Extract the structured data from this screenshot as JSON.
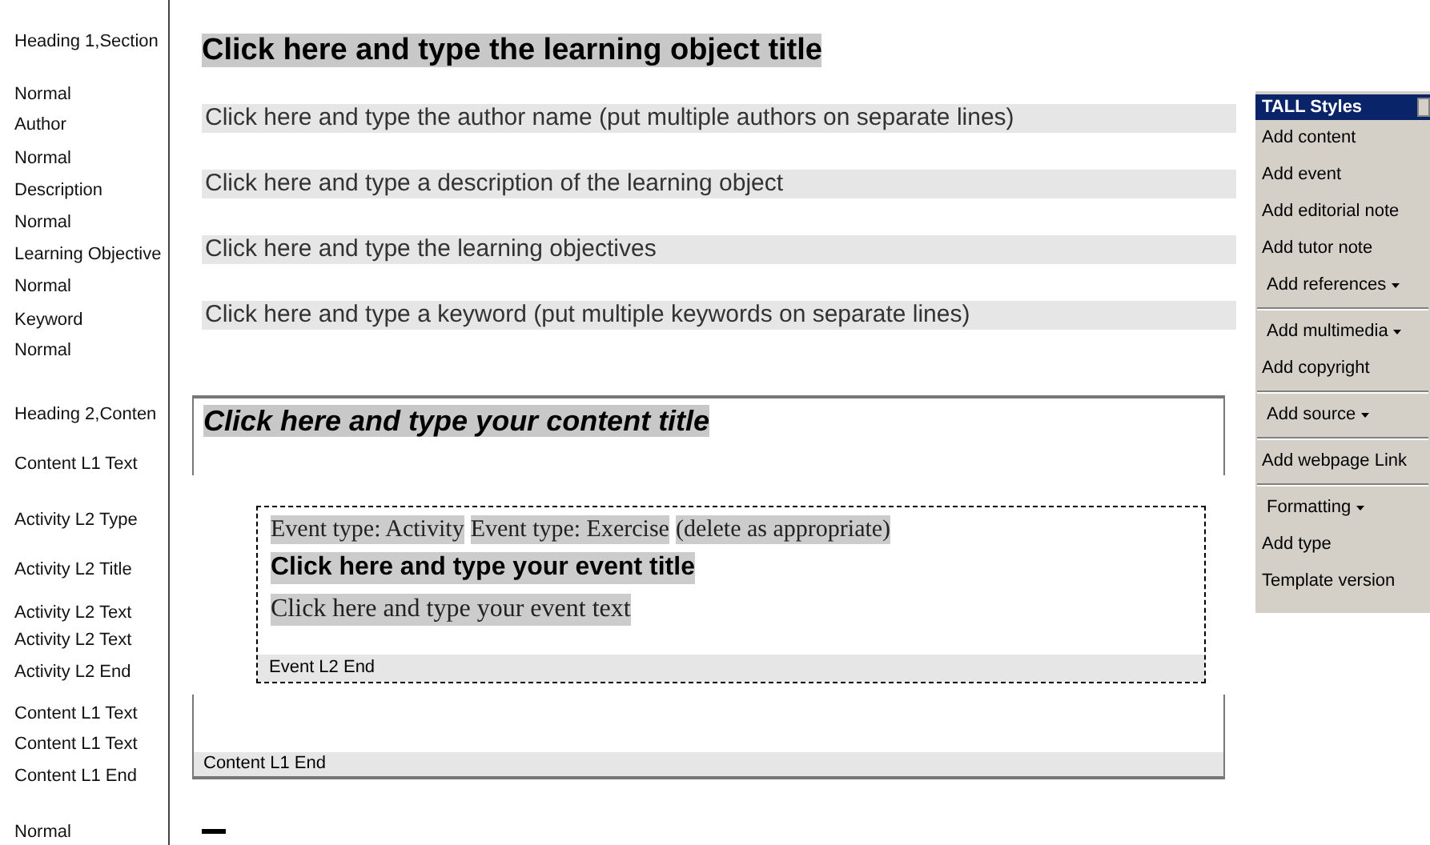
{
  "style_area": {
    "items": [
      "Heading 1,Section",
      "Normal",
      "Author",
      "Normal",
      "Description",
      "Normal",
      "Learning Objective",
      "Normal",
      "Keyword",
      "Normal",
      "Heading 2,Conten",
      "Content L1 Text",
      "Activity L2 Type",
      "Activity L2 Title",
      "Activity L2 Text",
      "Activity L2 Text",
      "Activity L2 End",
      "Content L1 Text",
      "Content L1 Text",
      "Content L1 End",
      "Normal"
    ]
  },
  "document": {
    "title": "Click here and type the learning object title",
    "fields": [
      "Click here and type the author name (put multiple authors on separate lines)",
      "Click here and type a description of the learning object",
      "Click here and type the learning objectives",
      "Click here and type a keyword (put multiple keywords on separate lines)"
    ],
    "content_section": {
      "title": "Click here and type your content title",
      "event": {
        "types": [
          "Event type: Activity",
          "Event type: Exercise",
          "(delete as appropriate)"
        ],
        "title": "Click here and type your event title",
        "text": "Click here and type your event text",
        "end_label": "Event L2 End"
      },
      "end_label": "Content L1 End"
    }
  },
  "toolbar": {
    "title": "TALL Styles",
    "groups": [
      [
        {
          "label": "Add content",
          "kind": "button"
        },
        {
          "label": "Add event",
          "kind": "button"
        },
        {
          "label": "Add editorial note",
          "kind": "button"
        },
        {
          "label": "Add tutor note",
          "kind": "button"
        },
        {
          "label": "Add references",
          "kind": "menu"
        }
      ],
      [
        {
          "label": "Add multimedia",
          "kind": "menu"
        },
        {
          "label": "Add copyright",
          "kind": "button"
        }
      ],
      [
        {
          "label": "Add source",
          "kind": "menu"
        }
      ],
      [
        {
          "label": "Add webpage Link",
          "kind": "button"
        }
      ],
      [
        {
          "label": "Formatting",
          "kind": "menu"
        },
        {
          "label": "Add type",
          "kind": "button"
        },
        {
          "label": "Template version",
          "kind": "button"
        }
      ]
    ]
  }
}
